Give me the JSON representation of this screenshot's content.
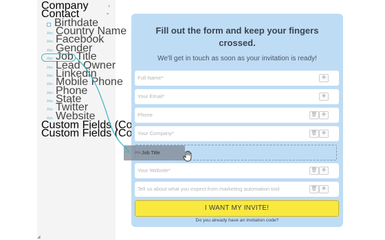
{
  "sidebar": {
    "groups": [
      {
        "label": "Company",
        "chevron": "›",
        "icon": "chevron-right-icon"
      },
      {
        "label": "Contact",
        "chevron": "⌄",
        "icon": "chevron-down-icon"
      },
      {
        "label": "Custom Fields (Company)",
        "chevron": "›",
        "icon": "chevron-right-icon"
      },
      {
        "label": "Custom Fields (Contact)",
        "chevron": "›",
        "icon": "chevron-right-icon"
      }
    ],
    "type_label": "Abc",
    "fields": [
      {
        "name": "Birthdate",
        "icon": "calendar-icon"
      },
      {
        "name": "Country Name",
        "icon": "text-type-icon"
      },
      {
        "name": "Facebook",
        "icon": "text-type-icon"
      },
      {
        "name": "Gender",
        "icon": "text-type-icon"
      },
      {
        "name": "Job Title",
        "icon": "text-type-icon"
      },
      {
        "name": "Lead Owner",
        "icon": "text-type-icon"
      },
      {
        "name": "Linkedin",
        "icon": "text-type-icon"
      },
      {
        "name": "Mobile Phone",
        "icon": "text-type-icon"
      },
      {
        "name": "Phone",
        "icon": "text-type-icon"
      },
      {
        "name": "State",
        "icon": "text-type-icon"
      },
      {
        "name": "Twitter",
        "icon": "text-type-icon"
      },
      {
        "name": "Website",
        "icon": "text-type-icon"
      }
    ],
    "corner_mark": "◢"
  },
  "form": {
    "title": "Fill out the form and keep your fingers crossed.",
    "subtitle": "We'll get in touch as soon as your invitation is ready!",
    "fields": [
      {
        "placeholder": "Full Name*",
        "buttons": [
          "move"
        ]
      },
      {
        "placeholder": "Your Email*",
        "buttons": [
          "move"
        ]
      },
      {
        "placeholder": "Phone",
        "buttons": [
          "delete",
          "move"
        ]
      },
      {
        "placeholder": "Your Company*",
        "buttons": [
          "delete",
          "move"
        ]
      },
      {
        "placeholder": "Your Website*",
        "buttons": [
          "delete",
          "move"
        ]
      },
      {
        "placeholder": "Tell us about what you expect from marketing automation tool",
        "buttons": [
          "delete",
          "move"
        ]
      }
    ],
    "button_glyphs": {
      "move": "✥",
      "delete": "🗑"
    },
    "cta_label": "I WANT MY INVITE!",
    "footer_text": "Do you already have an invitation code?"
  },
  "drag": {
    "type_label": "Abc",
    "field_name": "Job Title",
    "cursor_icon": "grab-hand-icon"
  },
  "colors": {
    "panel": "#bfdcf5",
    "accent": "#3fb9c6",
    "cta": "#f9e93e",
    "sidebar": "#f4f4f4"
  }
}
